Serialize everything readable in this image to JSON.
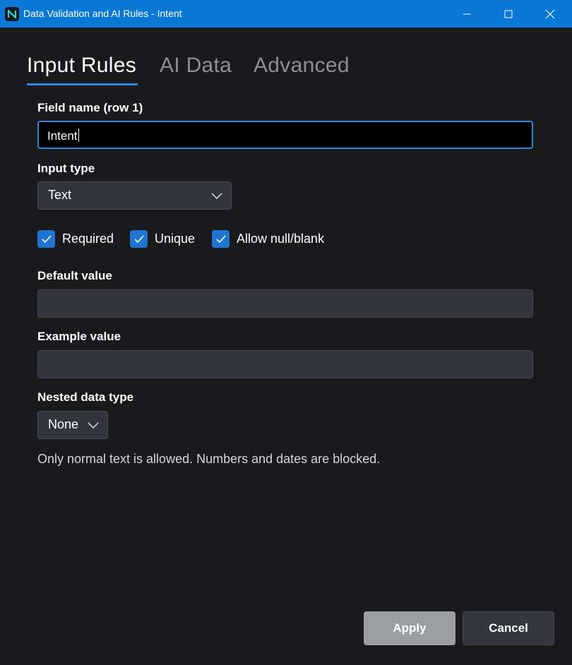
{
  "window": {
    "title": "Data Validation and AI Rules - Intent",
    "icon": "app-logo-icon",
    "controls": [
      "minimize-icon",
      "maximize-icon",
      "close-icon"
    ],
    "accent_color": "#0a78d4"
  },
  "tabs": [
    {
      "label": "Input Rules",
      "active": true
    },
    {
      "label": "AI Data",
      "active": false
    },
    {
      "label": "Advanced",
      "active": false
    }
  ],
  "form": {
    "field_name_label": "Field name (row 1)",
    "field_name_value": "Intent",
    "input_type_label": "Input type",
    "input_type_value": "Text",
    "checkboxes": [
      {
        "label": "Required",
        "checked": true
      },
      {
        "label": "Unique",
        "checked": true
      },
      {
        "label": "Allow null/blank",
        "checked": true
      }
    ],
    "default_value_label": "Default value",
    "default_value_value": "",
    "example_value_label": "Example value",
    "example_value_value": "",
    "nested_type_label": "Nested data type",
    "nested_type_value": "None",
    "hint_text": "Only normal text is allowed. Numbers and dates are blocked."
  },
  "actions": {
    "apply_label": "Apply",
    "cancel_label": "Cancel"
  }
}
